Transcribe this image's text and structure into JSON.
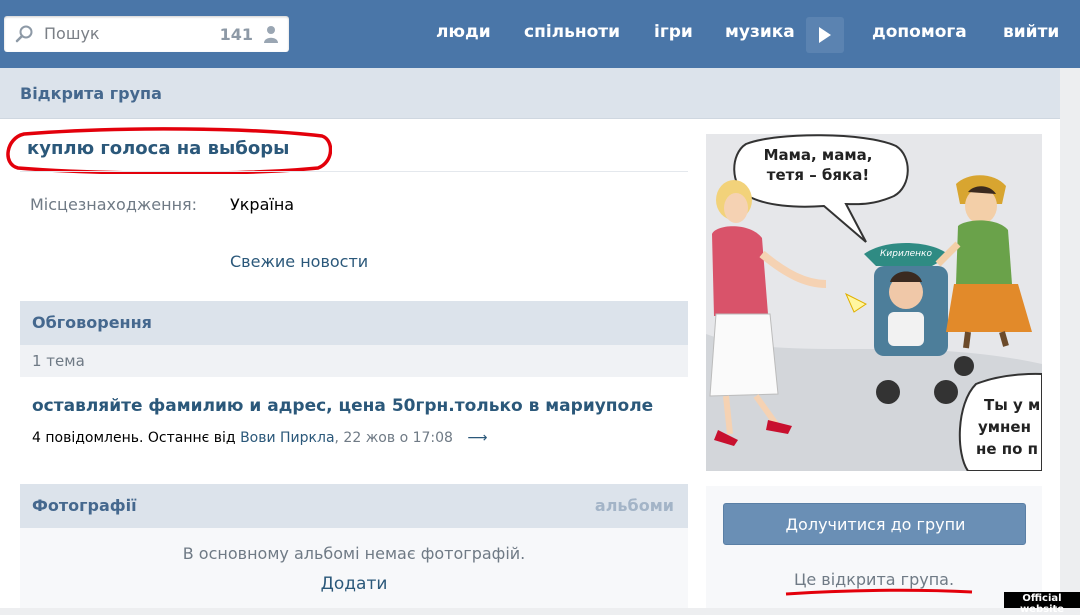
{
  "header": {
    "search_placeholder": "Пошук",
    "online_count": "141",
    "nav": [
      "люди",
      "спільноти",
      "ігри",
      "музика",
      "допомога",
      "вийти"
    ]
  },
  "page": {
    "group_type": "Відкрита група",
    "group_name": "куплю голоса на выборы",
    "location_label": "Місцезнаходження:",
    "location_value": "Україна",
    "news_link": "Свежие новости"
  },
  "discussions": {
    "title": "Обговорення",
    "count": "1 тема",
    "topic_title": "оставляйте фамилию и адрес, цена 50грн.только в мариуполе",
    "topic_posts": "4 повідомлень. Останнє від",
    "topic_author": "Вови Пиркла",
    "topic_date": ", 22 жов о 17:08",
    "topic_arrow": "⟶"
  },
  "photos": {
    "title": "Фотографії",
    "albums_link": "альбоми",
    "empty_text": "В основному альбомі немає фотографій.",
    "add_link": "Додати"
  },
  "poster": {
    "bubble_top": [
      "Мама, мама,",
      "тетя – бяка!"
    ],
    "stroller_label": "Кириленко",
    "bubble_bottom": [
      "Ты у м",
      "умнен",
      "не по п"
    ]
  },
  "sidebar": {
    "join_button": "Долучитися до групи",
    "open_note": "Це відкрита група."
  },
  "badge": "Official website",
  "colors": {
    "header_bg": "#4a76a8",
    "link": "#2b587a",
    "annotation_red": "#e3000b"
  }
}
